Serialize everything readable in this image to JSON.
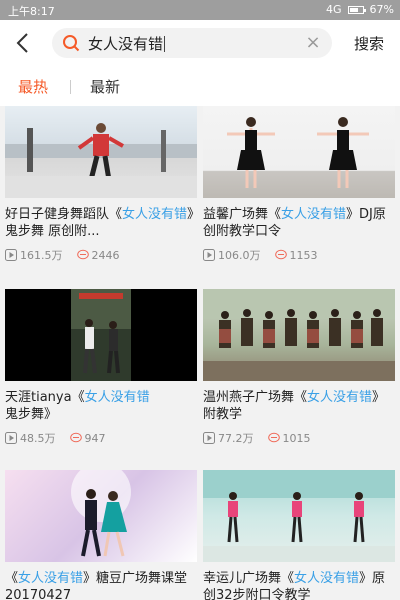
{
  "status": {
    "time": "上午8:17",
    "network": "4G",
    "battery": "67%",
    "battery_level": 0.67
  },
  "search": {
    "query": "女人没有错",
    "button": "搜索"
  },
  "tabs": {
    "hot": "最热",
    "new": "最新"
  },
  "colors": {
    "accent": "#f55a28",
    "keyword": "#3aa0e6"
  },
  "cards": [
    {
      "pre": "好日子健身舞蹈队《",
      "kw": "女人没有错",
      "post": "》鬼步舞 原创附...",
      "views": "161.5万",
      "comments": "2446"
    },
    {
      "pre": "益馨广场舞《",
      "kw": "女人没有错",
      "post": "》DJ原创附教学口令",
      "views": "106.0万",
      "comments": "1153"
    },
    {
      "pre": "天涯tianya《",
      "kw": "女人没有错",
      "post": "鬼步舞》",
      "views": "48.5万",
      "comments": "947"
    },
    {
      "pre": "温州燕子广场舞《",
      "kw": "女人没有错",
      "post": "》附教学",
      "views": "77.2万",
      "comments": "1015"
    },
    {
      "pre": "《",
      "kw": "女人没有错",
      "post": "》糖豆广场舞课堂 20170427",
      "views": "",
      "comments": ""
    },
    {
      "pre": "幸运儿广场舞《",
      "kw": "女人没有错",
      "post": "》原创32步附口令教学",
      "views": "",
      "comments": ""
    }
  ]
}
